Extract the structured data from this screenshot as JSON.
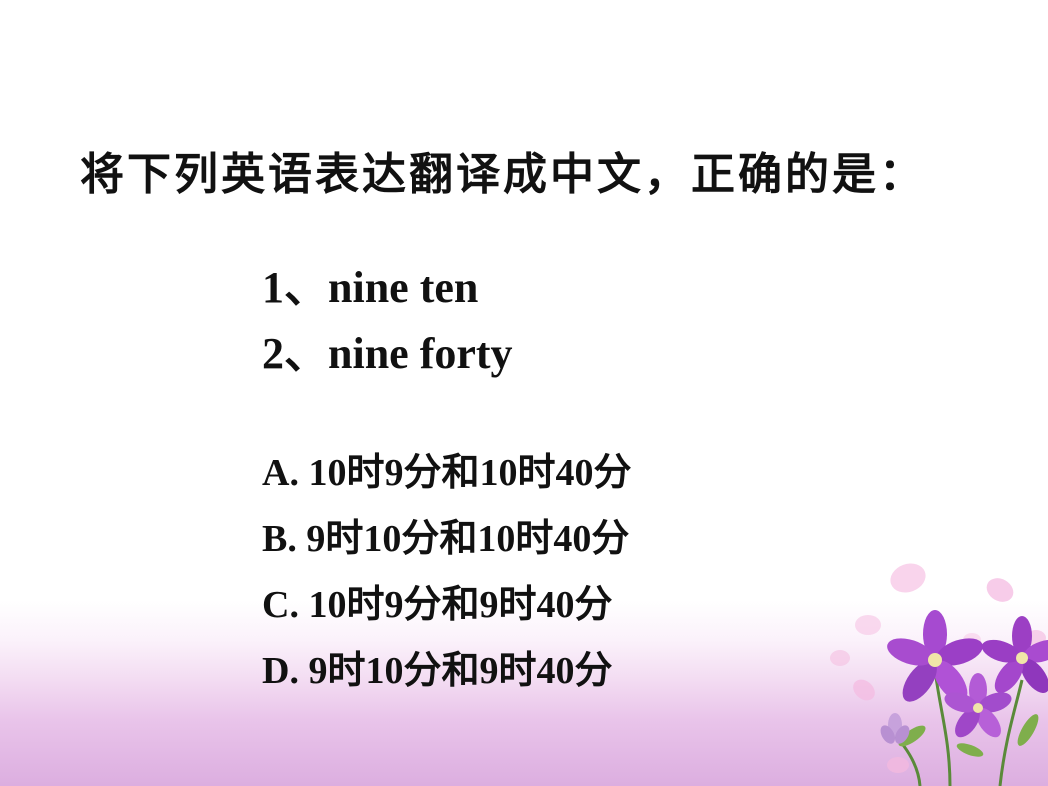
{
  "slide": {
    "title": "将下列英语表达翻译成中文，正确的是：",
    "questions": [
      "1、nine ten",
      "2、nine forty"
    ],
    "options": [
      "A. 10时9分和10时40分",
      "B. 9时10分和10时40分",
      "C. 10时9分和9时40分",
      "D. 9时10分和9时40分"
    ],
    "decoration": {
      "icon": "purple-flowers-with-petals",
      "petal_color": "#f6c6e6",
      "flower_color": "#9c3fc4"
    }
  }
}
